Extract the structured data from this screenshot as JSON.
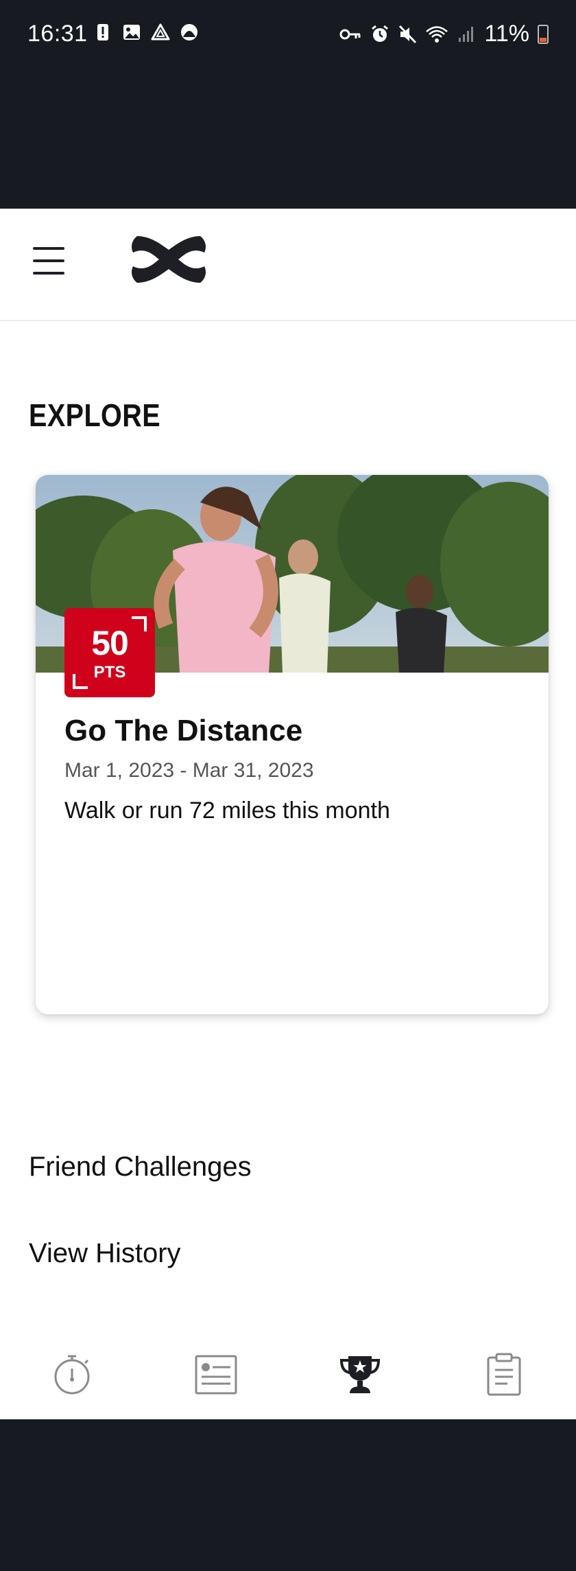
{
  "status_bar": {
    "time": "16:31",
    "battery_percent": "11%",
    "left_icons": [
      "alert-icon",
      "image-icon",
      "drive-icon",
      "circle-app-icon"
    ],
    "right_icons": [
      "vpn-key-icon",
      "alarm-icon",
      "mute-icon",
      "wifi-icon",
      "signal-icon",
      "battery-icon"
    ]
  },
  "app_bar": {
    "menu_icon": "hamburger-menu-icon",
    "logo": "under-armour-logo"
  },
  "explore": {
    "title": "EXPLORE"
  },
  "challenge_card": {
    "points": "50",
    "points_label": "PTS",
    "title": "Go The Distance",
    "dates": "Mar 1, 2023 - Mar 31, 2023",
    "description": "Walk or run 72 miles this month",
    "image": "runners-photo"
  },
  "links": {
    "friend_challenges": "Friend Challenges",
    "view_history": "View History"
  },
  "bottom_nav": {
    "items": [
      {
        "icon": "stopwatch-icon",
        "active": false
      },
      {
        "icon": "feed-icon",
        "active": false
      },
      {
        "icon": "trophy-icon",
        "active": true
      },
      {
        "icon": "clipboard-icon",
        "active": false
      }
    ]
  },
  "colors": {
    "badge_red": "#d0021b",
    "dark_bg": "#171b21",
    "text_dark": "#111111"
  }
}
